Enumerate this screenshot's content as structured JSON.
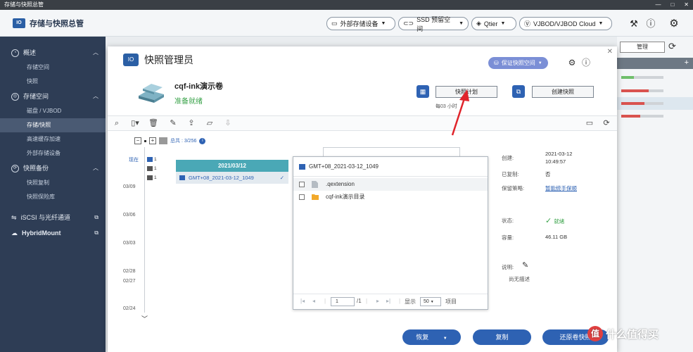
{
  "os_bar": {
    "title": "存储与快照总管",
    "controls": [
      "—",
      "□",
      "✕"
    ]
  },
  "header": {
    "app_title": "存储与快照总管",
    "external_storage": "外部存储设备",
    "ssd_reserve": "SSD 预留空间",
    "qtier": "Qtier",
    "vjbod": "VJBOD/VJBOD Cloud"
  },
  "sidebar": {
    "overview": "概述",
    "overview_items": [
      "存储空间",
      "快照"
    ],
    "storage_space": "存储空间",
    "storage_items": [
      "磁盘 / VJBOD",
      "存储/快照",
      "高速缓存加速",
      "外部存储设备"
    ],
    "snapshot_backup": "快照备份",
    "backup_items": [
      "快照复制",
      "快照保险库"
    ],
    "iscsi": "iSCSI 与光纤通道",
    "hybridmount": "HybridMount"
  },
  "background": {
    "manage_btn": "管理"
  },
  "modal": {
    "title": "快照管理员",
    "protect_label": "保证快照空间",
    "volume_name": "cqf-ink演示卷",
    "volume_status": "准备就绪",
    "schedule_btn": "快照计划",
    "schedule_note": "每03 小时",
    "create_btn": "创建快照"
  },
  "timeline": {
    "total": "总共 : 3/256",
    "now_label": "现在",
    "marks": [
      "1",
      "1",
      "1"
    ],
    "dates": [
      "03/09",
      "03/06",
      "03/03",
      "02/28",
      "02/27",
      "02/24"
    ],
    "group_date": "2021/03/12",
    "snapshot_name": "GMT+08_2021-03-12_1049"
  },
  "file_panel": {
    "title": "GMT+08_2021-03-12_1049",
    "rows": [
      ".qextension",
      "cqf-ink演示目录"
    ],
    "page_value": "1",
    "page_total": "/1",
    "display_label": "显示",
    "page_size": "50",
    "items_label": "项目"
  },
  "properties": {
    "created_k": "创建:",
    "created_date": "2021-03-12",
    "created_time": "10:49:57",
    "replicated_k": "已复制:",
    "replicated_v": "否",
    "retention_k": "保留策略:",
    "retention_v": "暂能统手保顺",
    "status_k": "状态:",
    "status_v": "就绪",
    "capacity_k": "容量:",
    "capacity_v": "46.11 GB",
    "desc_k": "说明:",
    "desc_v": "尚无描述"
  },
  "buttons": {
    "restore": "恢复",
    "copy": "复制",
    "revert": "还原卷快照"
  },
  "watermark": {
    "badge": "值",
    "text": "什么值得买"
  },
  "colors": {
    "accent": "#2e62b3",
    "sidebar": "#2e3d55",
    "teal": "#4aa8b6",
    "ok": "#3aa34a"
  }
}
